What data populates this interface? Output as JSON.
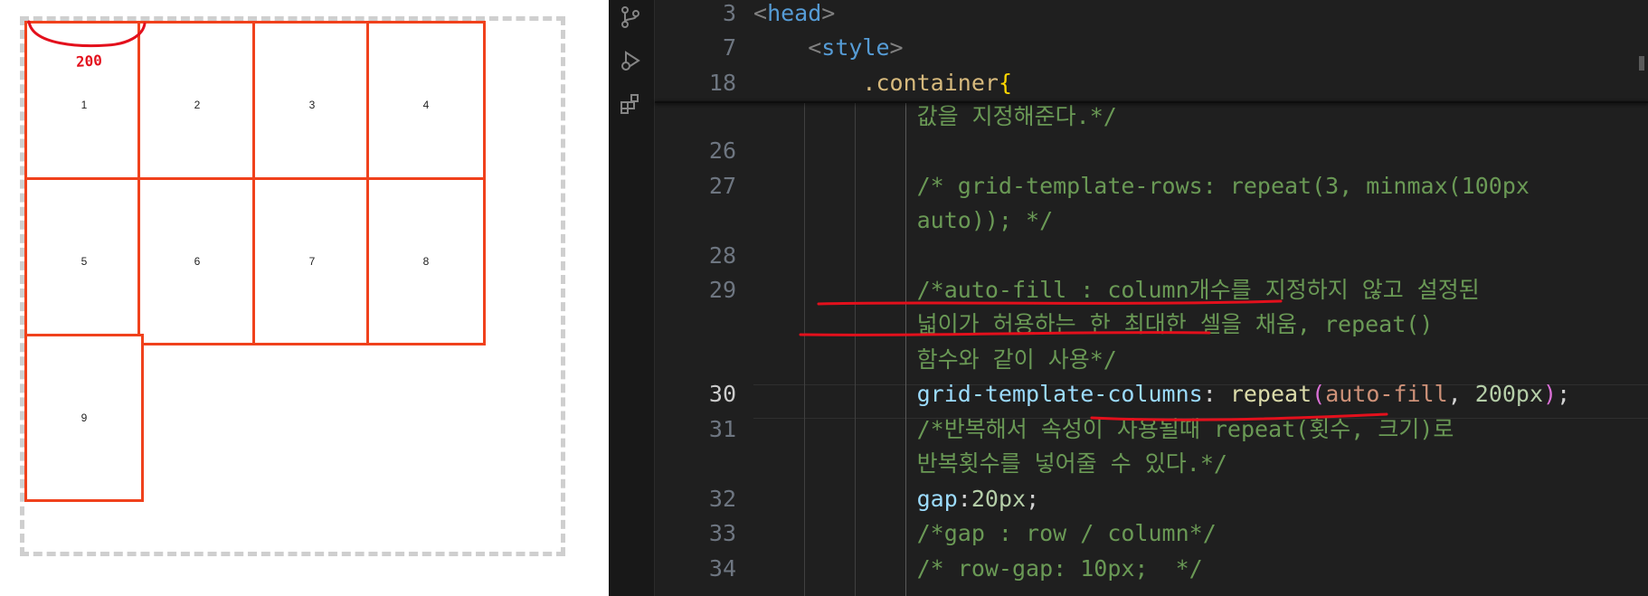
{
  "preview": {
    "cells": [
      "1",
      "2",
      "3",
      "4",
      "5",
      "6",
      "7",
      "8",
      "9"
    ],
    "annotation": "200"
  },
  "editor": {
    "activity_icons": [
      "source-control-icon",
      "run-debug-icon",
      "extensions-icon"
    ],
    "line_numbers": [
      "3",
      "7",
      "18",
      "",
      "26",
      "27",
      "",
      "28",
      "29",
      "",
      "",
      "30",
      "31",
      "",
      "32",
      "33",
      "34"
    ],
    "active_line": "30",
    "lines": [
      [
        {
          "t": "<",
          "c": "c-punc"
        },
        {
          "t": "head",
          "c": "c-tag"
        },
        {
          "t": ">",
          "c": "c-punc"
        }
      ],
      [
        {
          "t": "    <",
          "c": "c-punc"
        },
        {
          "t": "style",
          "c": "c-tag"
        },
        {
          "t": ">",
          "c": "c-punc"
        }
      ],
      [
        {
          "t": "        .container",
          "c": "c-sel"
        },
        {
          "t": "{",
          "c": "c-brace"
        }
      ],
      [
        {
          "t": "            값을 지정해준다.*/",
          "c": "c-com"
        }
      ],
      [
        {
          "t": "",
          "c": "c-txt"
        }
      ],
      [
        {
          "t": "            /* grid-template-rows: repeat(3, minmax(100px",
          "c": "c-com"
        }
      ],
      [
        {
          "t": "            auto)); */",
          "c": "c-com"
        }
      ],
      [
        {
          "t": "",
          "c": "c-txt"
        }
      ],
      [
        {
          "t": "            /*auto-fill : column개수를 지정하지 않고 설정된",
          "c": "c-com"
        }
      ],
      [
        {
          "t": "            넓이가 허용하는 한 최대한 셀을 채움, repeat()",
          "c": "c-com"
        }
      ],
      [
        {
          "t": "            함수와 같이 사용*/",
          "c": "c-com"
        }
      ],
      [
        {
          "t": "            grid-template-columns",
          "c": "c-prop"
        },
        {
          "t": ": ",
          "c": "c-txt"
        },
        {
          "t": "repeat",
          "c": "c-fn"
        },
        {
          "t": "(",
          "c": "c-paren1"
        },
        {
          "t": "auto-fill",
          "c": "c-kw"
        },
        {
          "t": ", ",
          "c": "c-txt"
        },
        {
          "t": "200px",
          "c": "c-num"
        },
        {
          "t": ")",
          "c": "c-paren1"
        },
        {
          "t": ";",
          "c": "c-txt"
        }
      ],
      [
        {
          "t": "            /*반복해서 속성이 사용될때 repeat(횟수, 크기)로",
          "c": "c-com"
        }
      ],
      [
        {
          "t": "            반복횟수를 넣어줄 수 있다.*/",
          "c": "c-com"
        }
      ],
      [
        {
          "t": "            gap",
          "c": "c-prop"
        },
        {
          "t": ":",
          "c": "c-txt"
        },
        {
          "t": "20px",
          "c": "c-num"
        },
        {
          "t": ";",
          "c": "c-txt"
        }
      ],
      [
        {
          "t": "            /*gap : row / column*/",
          "c": "c-com"
        }
      ],
      [
        {
          "t": "            /* row-gap: 10px;  */",
          "c": "c-com"
        }
      ]
    ]
  },
  "colors": {
    "cell_border": "#f0411c",
    "annotation": "#e3101c",
    "editor_bg": "#1f1f1f"
  }
}
